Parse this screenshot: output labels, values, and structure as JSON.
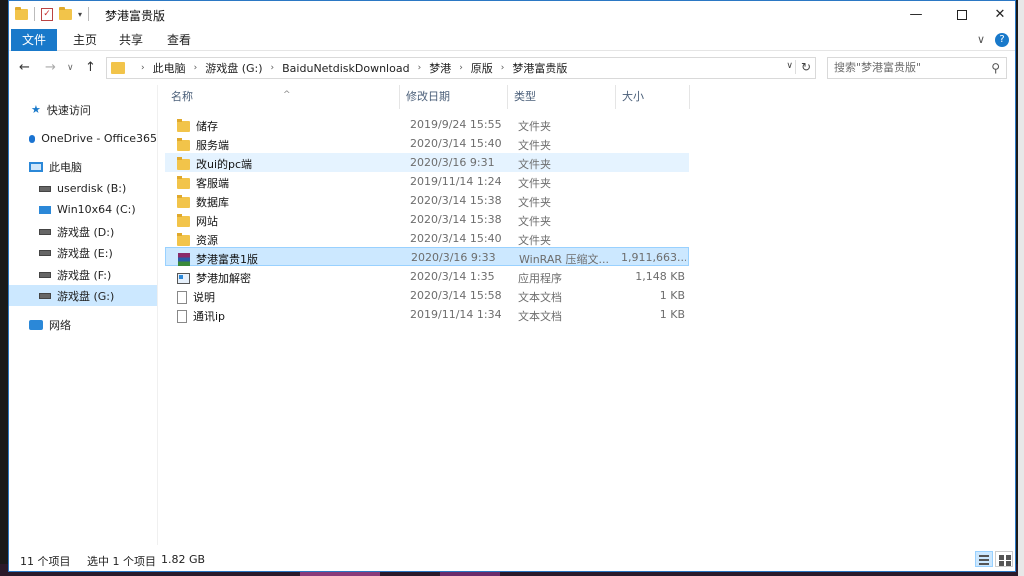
{
  "window": {
    "title": "梦港富贵版",
    "minimize": "—",
    "close": "✕"
  },
  "ribbon": {
    "tabs": [
      "文件",
      "主页",
      "共享",
      "查看"
    ],
    "expand": "∨",
    "help": "?"
  },
  "address": {
    "crumbs": [
      "此电脑",
      "游戏盘 (G:)",
      "BaiduNetdiskDownload",
      "梦港",
      "原版",
      "梦港富贵版"
    ],
    "search_placeholder": "搜索\"梦港富贵版\""
  },
  "nav": {
    "items": [
      {
        "label": "快速访问",
        "icon": "star-icon"
      },
      {
        "label": "OneDrive - Office365",
        "icon": "cloud-icon"
      },
      {
        "label": "此电脑",
        "icon": "pc-icon"
      },
      {
        "label": "userdisk (B:)",
        "icon": "drive-icon"
      },
      {
        "label": "Win10x64 (C:)",
        "icon": "windows-drive-icon"
      },
      {
        "label": "游戏盘 (D:)",
        "icon": "drive-icon"
      },
      {
        "label": "游戏盘 (E:)",
        "icon": "drive-icon"
      },
      {
        "label": "游戏盘 (F:)",
        "icon": "drive-icon"
      },
      {
        "label": "游戏盘 (G:)",
        "icon": "drive-icon"
      },
      {
        "label": "网络",
        "icon": "network-icon"
      }
    ]
  },
  "columns": {
    "name": "名称",
    "date": "修改日期",
    "type": "类型",
    "size": "大小",
    "sort_indicator": "^"
  },
  "files": [
    {
      "name": "储存",
      "date": "2019/9/24 15:55",
      "type": "文件夹",
      "size": "",
      "icon": "folder-icon"
    },
    {
      "name": "服务端",
      "date": "2020/3/14 15:40",
      "type": "文件夹",
      "size": "",
      "icon": "folder-icon"
    },
    {
      "name": "改ui的pc端",
      "date": "2020/3/16 9:31",
      "type": "文件夹",
      "size": "",
      "icon": "folder-icon"
    },
    {
      "name": "客服端",
      "date": "2019/11/14 1:24",
      "type": "文件夹",
      "size": "",
      "icon": "folder-icon"
    },
    {
      "name": "数据库",
      "date": "2020/3/14 15:38",
      "type": "文件夹",
      "size": "",
      "icon": "folder-icon"
    },
    {
      "name": "网站",
      "date": "2020/3/14 15:38",
      "type": "文件夹",
      "size": "",
      "icon": "folder-icon"
    },
    {
      "name": "资源",
      "date": "2020/3/14 15:40",
      "type": "文件夹",
      "size": "",
      "icon": "folder-icon"
    },
    {
      "name": "梦港富贵1版",
      "date": "2020/3/16 9:33",
      "type": "WinRAR 压缩文...",
      "size": "1,911,663...",
      "icon": "rar-icon"
    },
    {
      "name": "梦港加解密",
      "date": "2020/3/14 1:35",
      "type": "应用程序",
      "size": "1,148 KB",
      "icon": "exe-icon"
    },
    {
      "name": "说明",
      "date": "2020/3/14 15:58",
      "type": "文本文档",
      "size": "1 KB",
      "icon": "txt-icon"
    },
    {
      "name": "通讯ip",
      "date": "2019/11/14 1:34",
      "type": "文本文档",
      "size": "1 KB",
      "icon": "txt-icon"
    }
  ],
  "status": {
    "count": "11 个项目",
    "selected": "选中 1 个项目",
    "size": "1.82 GB"
  }
}
